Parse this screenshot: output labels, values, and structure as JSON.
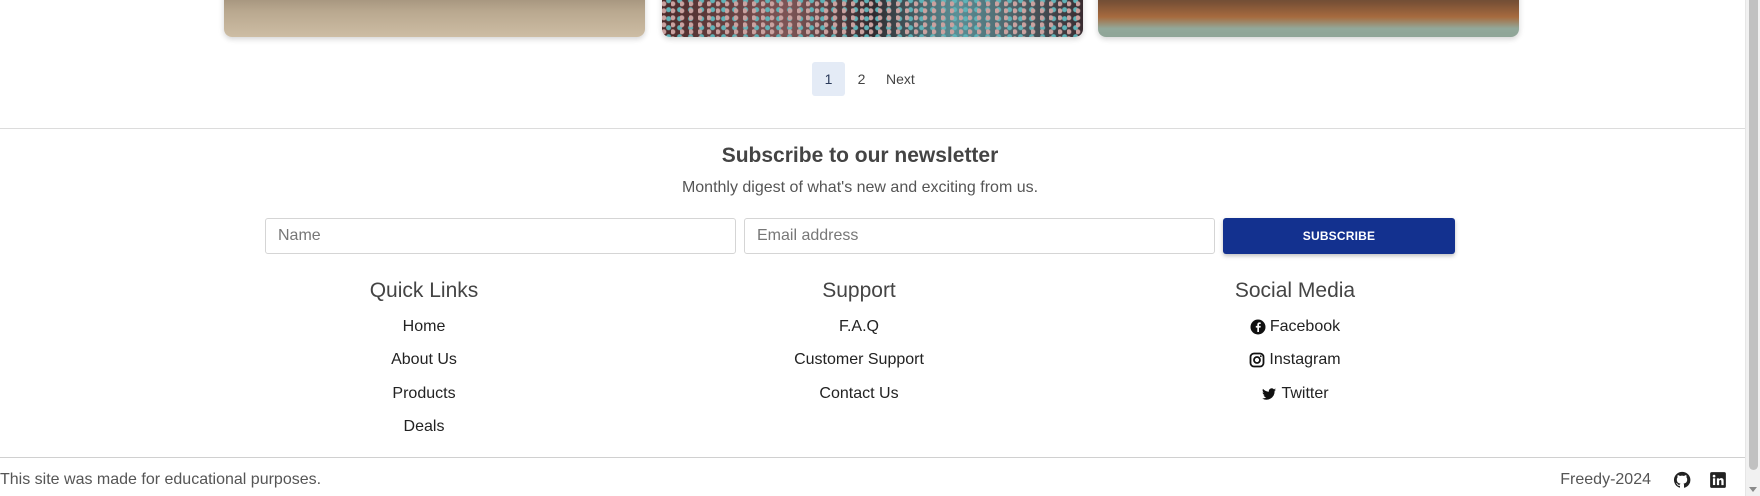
{
  "pagination": {
    "pages": [
      "1",
      "2"
    ],
    "active": "1",
    "next_label": "Next"
  },
  "newsletter": {
    "title": "Subscribe to our newsletter",
    "subtitle": "Monthly digest of what's new and exciting from us.",
    "name_placeholder": "Name",
    "email_placeholder": "Email address",
    "subscribe_label": "SUBSCRIBE"
  },
  "quick_links": {
    "title": "Quick Links",
    "items": [
      "Home",
      "About Us",
      "Products",
      "Deals"
    ]
  },
  "support": {
    "title": "Support",
    "items": [
      "F.A.Q",
      "Customer Support",
      "Contact Us"
    ]
  },
  "social": {
    "title": "Social Media",
    "items": [
      {
        "label": "Facebook",
        "icon": "facebook-icon"
      },
      {
        "label": "Instagram",
        "icon": "instagram-icon"
      },
      {
        "label": "Twitter",
        "icon": "twitter-icon"
      }
    ]
  },
  "footer": {
    "note": "This site was made for educational purposes.",
    "copyright": "Freedy-2024",
    "icons": [
      "github-icon",
      "linkedin-icon"
    ]
  },
  "colors": {
    "primary": "#13318f",
    "active_page_bg": "#e4ebf6"
  }
}
